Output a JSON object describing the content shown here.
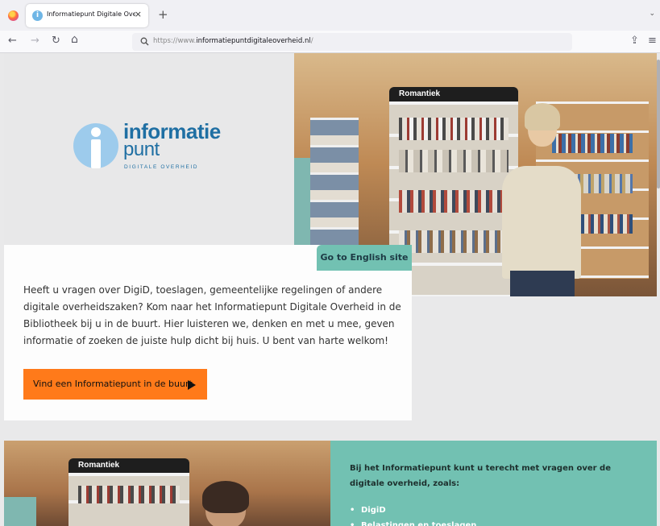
{
  "browser": {
    "tab_title": "Informatiepunt Digitale Overheid",
    "tab_close": "×",
    "new_tab": "+",
    "tab_list": "⌄",
    "url_prefix": "https://www.",
    "url_domain": "informatiepuntdigitaleoverheid.nl",
    "url_suffix": "/",
    "back": "←",
    "forward": "→",
    "reload": "↻",
    "home": "⌂",
    "share": "⇪",
    "menu": "≡"
  },
  "logo": {
    "line1": "informatie",
    "line2": "punt",
    "line3": "DIGITALE OVERHEID",
    "color": "#1f6fa3",
    "circle_color": "#9dcbec"
  },
  "hero": {
    "sign_text": "Romantiek",
    "english_button": "Go to English site"
  },
  "intro": {
    "text": "Heeft u vragen over DigiD, toeslagen, gemeentelijke regelingen of andere digitale overheidszaken? Kom naar het Informatiepunt Digitale Overheid in de Bibliotheek bij u in de buurt. Hier luisteren we, denken en met u mee, geven informatie of zoeken de juiste hulp dicht bij huis. U bent van harte welkom!",
    "cta_label": "Vind een Informatiepunt in de buurt",
    "cta_color": "#ff7a1a"
  },
  "second": {
    "sign_text": "Romantiek",
    "title": "Bij het Informatiepunt kunt u terecht met vragen over de digitale overheid, zoals:",
    "bullets": [
      "DigiD",
      "Belastingen en toeslagen"
    ],
    "panel_color": "#72c1b2"
  }
}
